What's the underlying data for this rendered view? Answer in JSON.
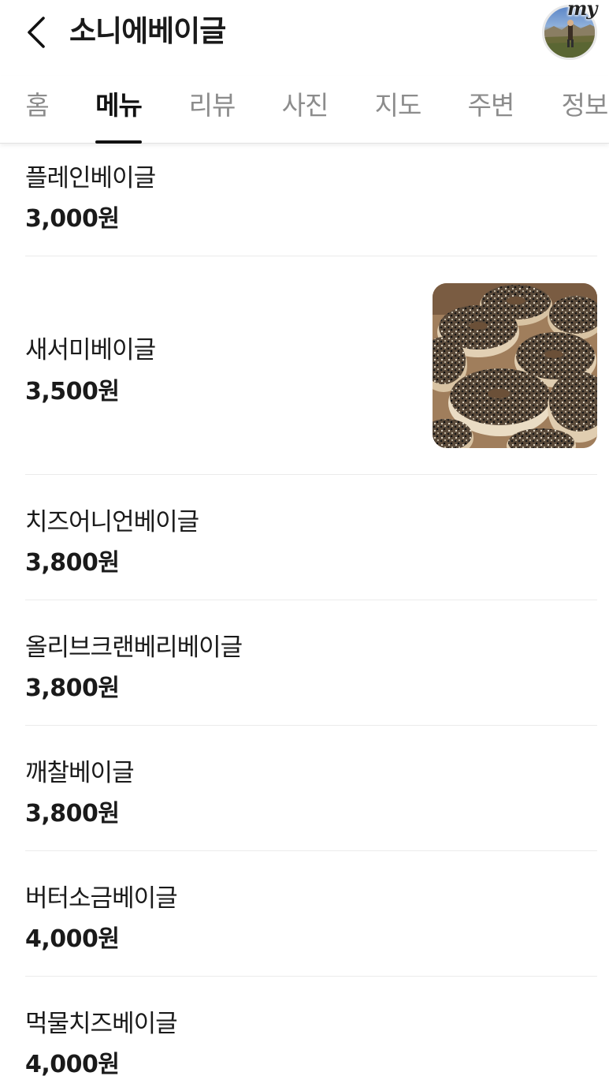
{
  "header": {
    "title": "소니에베이글",
    "back_icon": "chevron-left-icon",
    "avatar_badge": "my"
  },
  "tabs": [
    {
      "label": "홈",
      "active": false
    },
    {
      "label": "메뉴",
      "active": true
    },
    {
      "label": "리뷰",
      "active": false
    },
    {
      "label": "사진",
      "active": false
    },
    {
      "label": "지도",
      "active": false
    },
    {
      "label": "주변",
      "active": false
    },
    {
      "label": "정보",
      "active": false
    }
  ],
  "menu": [
    {
      "name": "플레인베이글",
      "price": "3,000원"
    },
    {
      "name": "새서미베이글",
      "price": "3,500원",
      "has_photo": true
    },
    {
      "name": "치즈어니언베이글",
      "price": "3,800원"
    },
    {
      "name": "올리브크랜베리베이글",
      "price": "3,800원"
    },
    {
      "name": "깨찰베이글",
      "price": "3,800원"
    },
    {
      "name": "버터소금베이글",
      "price": "4,000원"
    },
    {
      "name": "먹물치즈베이글",
      "price": "4,000원"
    }
  ],
  "colors": {
    "text": "#1a1a1a",
    "tab_inactive": "#8c8c8c",
    "tab_indicator": "#111111",
    "divider": "#ebebeb"
  }
}
